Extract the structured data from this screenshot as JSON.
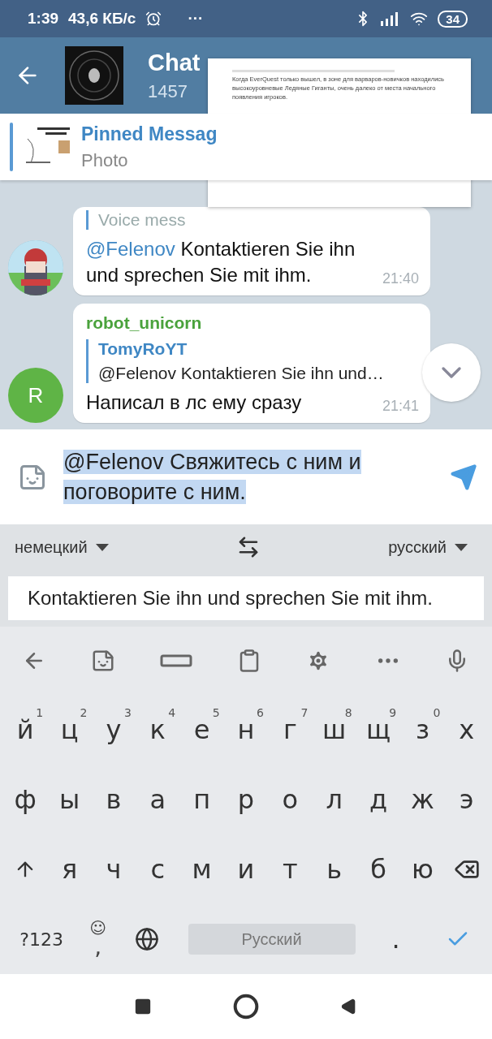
{
  "status_bar": {
    "time": "1:39",
    "speed": "43,6 КБ/с",
    "more": "···",
    "battery": "34"
  },
  "header": {
    "title": "Chat",
    "subtitle": "1457"
  },
  "pinned": {
    "title": "Pinned Messag",
    "subtitle": "Photo"
  },
  "messages": [
    {
      "kind": "partial",
      "reply_text": "Voice mess",
      "mention": "@Felenov",
      "text": "Kontaktieren Sie ihn und sprechen Sie mit ihm.",
      "time": "21:40"
    },
    {
      "kind": "full",
      "avatar_letter": "R",
      "color": "#5fb446",
      "sender": "robot_unicorn",
      "reply_author": "TomyRoYT",
      "reply_text": "@Felenov Kontaktieren Sie ihn und…",
      "text": "Написал в лс ему сразу",
      "time": "21:41"
    }
  ],
  "composer": {
    "value": "@Felenov Свяжитесь с ним и поговорите с ним.",
    "selected": true
  },
  "translate": {
    "from": "немецкий",
    "to": "русский",
    "value": "Kontaktieren Sie ihn und sprechen Sie mit ihm."
  },
  "keyboard": {
    "rows": [
      [
        {
          "key": "й",
          "hint": "1"
        },
        {
          "key": "ц",
          "hint": "2"
        },
        {
          "key": "у",
          "hint": "3"
        },
        {
          "key": "к",
          "hint": "4"
        },
        {
          "key": "е",
          "hint": "5"
        },
        {
          "key": "н",
          "hint": "6"
        },
        {
          "key": "г",
          "hint": "7"
        },
        {
          "key": "ш",
          "hint": "8"
        },
        {
          "key": "щ",
          "hint": "9"
        },
        {
          "key": "з",
          "hint": "0"
        },
        {
          "key": "х"
        }
      ],
      [
        {
          "key": "ф"
        },
        {
          "key": "ы"
        },
        {
          "key": "в"
        },
        {
          "key": "а"
        },
        {
          "key": "п"
        },
        {
          "key": "р"
        },
        {
          "key": "о"
        },
        {
          "key": "л"
        },
        {
          "key": "д"
        },
        {
          "key": "ж"
        },
        {
          "key": "э"
        }
      ],
      [
        {
          "kind": "shift"
        },
        {
          "key": "я"
        },
        {
          "key": "ч"
        },
        {
          "key": "с"
        },
        {
          "key": "м"
        },
        {
          "key": "и"
        },
        {
          "key": "т"
        },
        {
          "key": "ь"
        },
        {
          "key": "б"
        },
        {
          "key": "ю"
        },
        {
          "kind": "backspace"
        }
      ]
    ],
    "bottom": {
      "symbols": "?123",
      "emoji": "☺",
      "comma": ",",
      "space": "Русский",
      "period": "."
    }
  },
  "popup": {
    "text": "Когда EverQuest только вышел, в зоне для варваров-новичков находились высокоуровневые Ледяные Гиганты, очень далеко от места начального появления игроков."
  }
}
